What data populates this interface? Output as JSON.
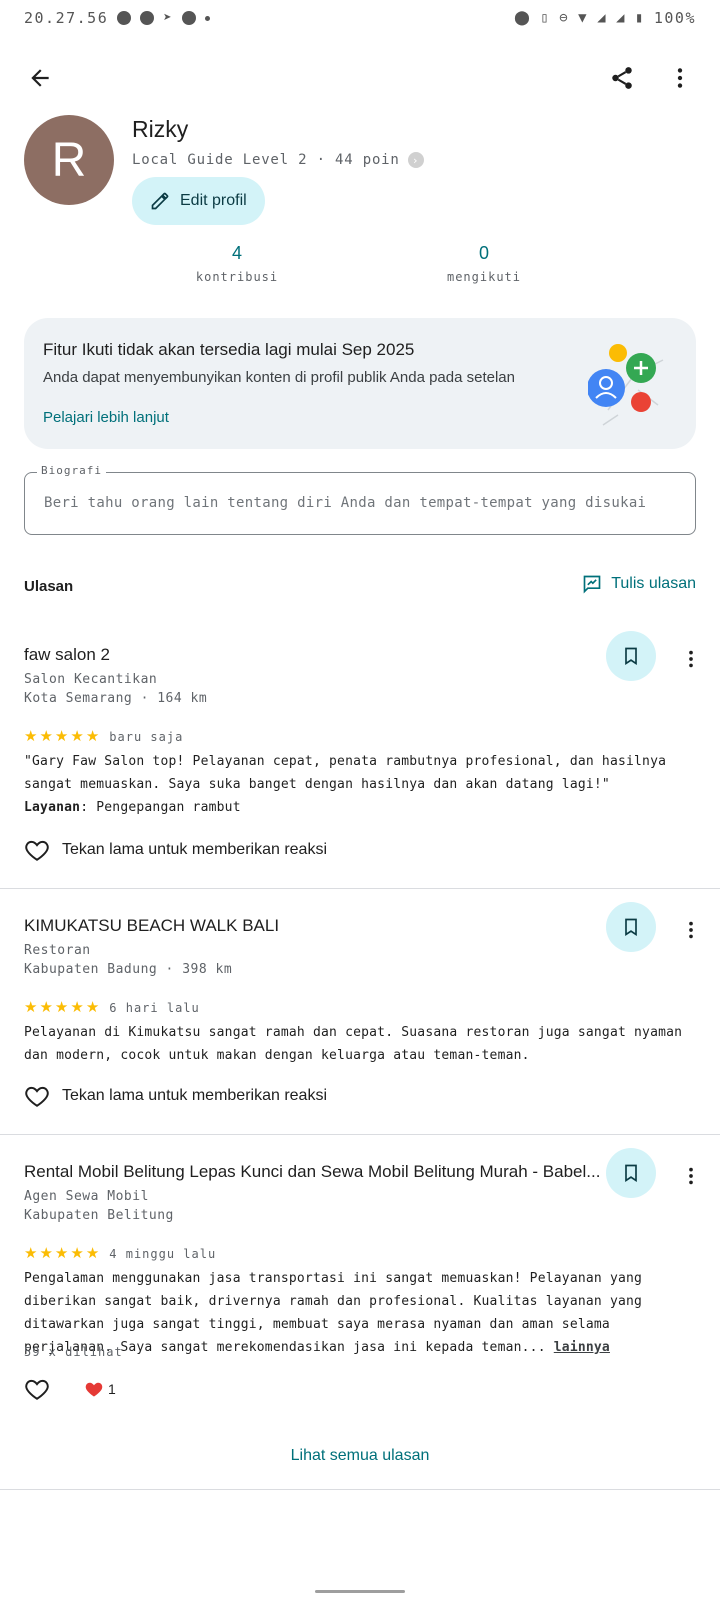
{
  "status_bar": {
    "time": "20.27.56",
    "battery": "100%"
  },
  "profile": {
    "initial": "R",
    "name": "Rizky",
    "level": "Local Guide Level 2 · 44 poin",
    "edit_label": "Edit profil",
    "stats": [
      {
        "value": "4",
        "label": "kontribusi"
      },
      {
        "value": "0",
        "label": "mengikuti"
      }
    ]
  },
  "notice": {
    "title": "Fitur Ikuti tidak akan tersedia lagi mulai Sep 2025",
    "text": "Anda dapat menyembunyikan konten di profil publik Anda pada setelan",
    "link": "Pelajari lebih lanjut"
  },
  "bio": {
    "label": "Biografi",
    "placeholder": "Beri tahu orang lain tentang diri Anda dan tempat-tempat yang disukai"
  },
  "reviews_section": {
    "title": "Ulasan",
    "write_label": "Tulis ulasan",
    "see_all": "Lihat semua ulasan"
  },
  "reviews": [
    {
      "title": "faw salon 2",
      "category": "Salon Kecantikan",
      "location": "Kota Semarang · 164 km",
      "rating": 5,
      "when": "baru saja",
      "body": "\"Gary Faw Salon top! Pelayanan cepat, penata rambutnya profesional, dan hasilnya sangat memuaskan. Saya suka banget dengan hasilnya dan akan datang lagi!\"",
      "service_label": "Layanan",
      "service_value": ": Pengepangan rambut",
      "react_label": "Tekan lama untuk memberikan reaksi"
    },
    {
      "title": "KIMUKATSU BEACH WALK BALI",
      "category": "Restoran",
      "location": "Kabupaten Badung · 398 km",
      "rating": 5,
      "when": "6 hari lalu",
      "body": "Pelayanan di Kimukatsu sangat ramah dan cepat. Suasana restoran juga sangat nyaman dan modern, cocok untuk makan dengan keluarga atau teman-teman.",
      "react_label": "Tekan lama untuk memberikan reaksi"
    },
    {
      "title": "Rental Mobil Belitung Lepas Kunci dan Sewa Mobil Belitung Murah - Babel...",
      "category": "Agen Sewa Mobil",
      "location": "Kabupaten Belitung",
      "rating": 5,
      "when": "4 minggu lalu",
      "body": "Pengalaman menggunakan jasa transportasi ini sangat memuaskan! Pelayanan yang diberikan sangat baik, drivernya ramah dan profesional. Kualitas layanan yang ditawarkan juga sangat tinggi, membuat saya merasa nyaman dan aman selama perjalanan. Saya sangat merekomendasikan jasa ini kepada teman...",
      "more_label": "lainnya",
      "views": "59 x dilihat",
      "heart_count": "1"
    }
  ],
  "colors": {
    "accent": "#00707a",
    "chip": "#d3f3f8",
    "avatar": "#8d6e63",
    "star": "#fbbc04"
  }
}
